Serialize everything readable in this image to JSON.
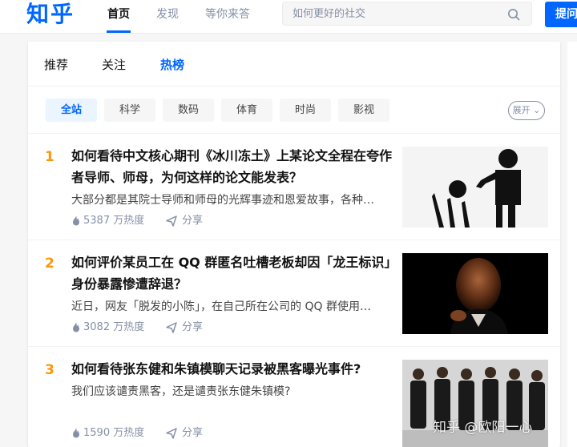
{
  "header": {
    "logo": "知乎",
    "nav": [
      "首页",
      "发现",
      "等你来答"
    ],
    "search_placeholder": "如何更好的社交",
    "ask_label": "提问"
  },
  "tabs": [
    "推荐",
    "关注",
    "热榜"
  ],
  "filters": [
    "全站",
    "科学",
    "数码",
    "体育",
    "时尚",
    "影视"
  ],
  "expand_label": "展开",
  "items": [
    {
      "rank": "1",
      "title": "如何看待中文核心期刊《冰川冻土》上某论文全程在夸作者导师、师母，为何这样的论文能发表？",
      "excerpt": "大部分都是其院士导师和师母的光辉事迹和恩爱故事，各种…",
      "heat": "5387 万热度",
      "share": "分享"
    },
    {
      "rank": "2",
      "title": "如何评价某员工在 QQ 群匿名吐槽老板却因「龙王标识」身份暴露惨遭辞退？",
      "excerpt": "近日，网友「脱发的小陈」，在自己所在公司的 QQ 群使用…",
      "heat": "3082 万热度",
      "share": "分享"
    },
    {
      "rank": "3",
      "title": "如何看待张东健和朱镇模聊天记录被黑客曝光事件?",
      "excerpt": "我们应该谴责黑客，还是谴责张东健朱镇模?",
      "heat": "1590 万热度",
      "share": "分享"
    }
  ],
  "watermark": "知乎 @欧阳一心",
  "colors": {
    "brand": "#0066ff",
    "rank": "#ff9607"
  },
  "icons": [
    "search-icon",
    "fire-icon",
    "share-icon"
  ]
}
